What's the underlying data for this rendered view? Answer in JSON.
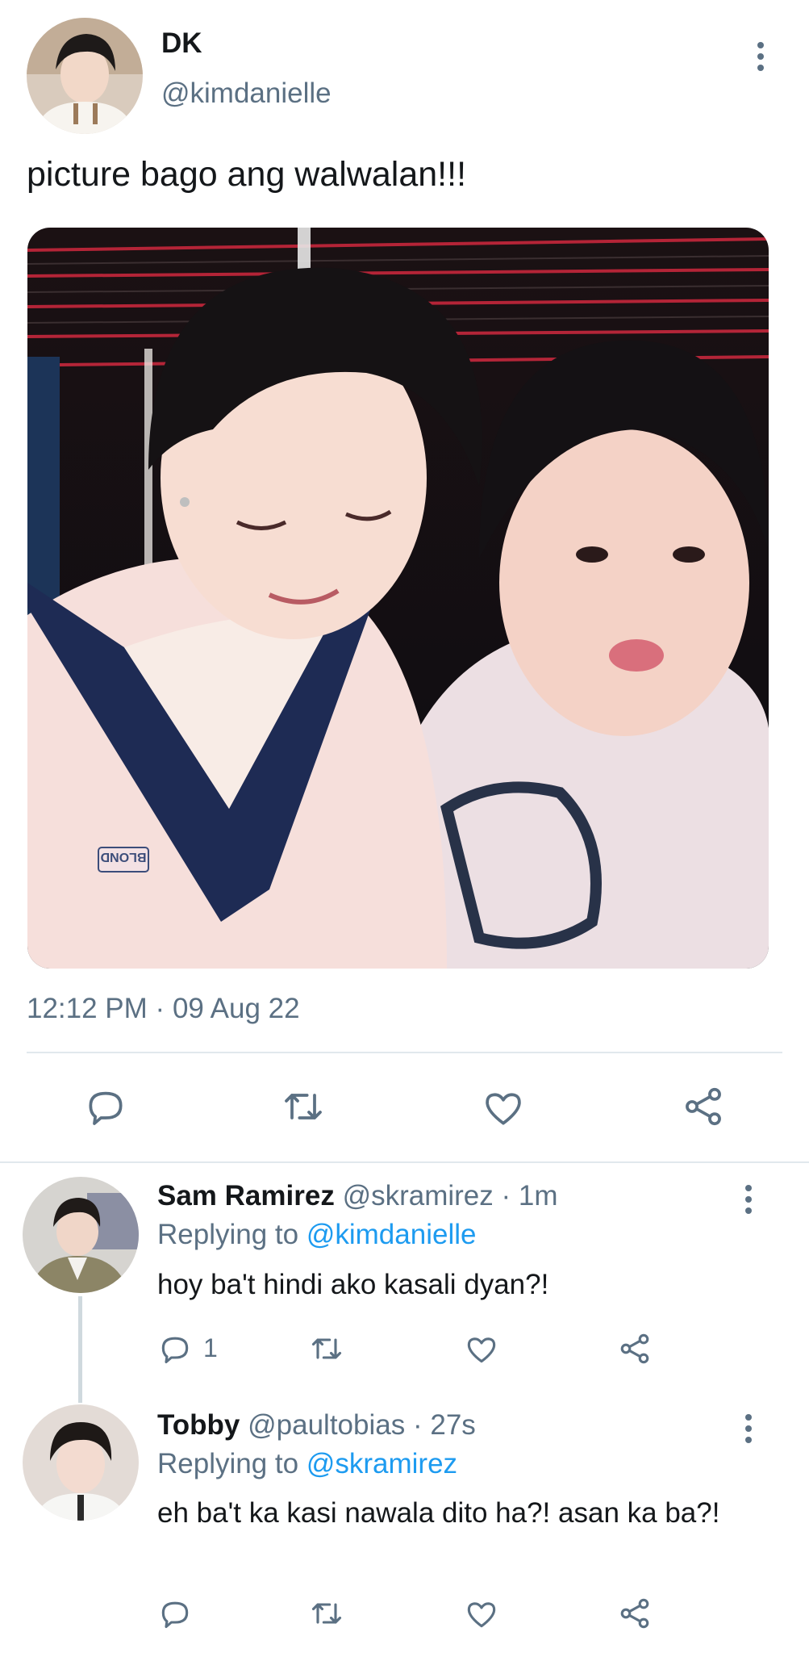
{
  "main_tweet": {
    "display_name": "DK",
    "handle": "@kimdanielle",
    "text": "picture bago ang walwalan!!!",
    "photo_text": "BLOND",
    "timestamp": "12:12 PM",
    "date": "09 Aug 22",
    "separator": "·"
  },
  "replies": [
    {
      "display_name": "Sam Ramirez",
      "handle": "@skramirez",
      "time": "1m",
      "separator": "·",
      "replying_label": "Replying to",
      "replying_to": "@kimdanielle",
      "text": "hoy ba't hindi ako kasali dyan?!",
      "reply_count": "1"
    },
    {
      "display_name": "Tobby",
      "handle": "@paultobias",
      "time": "27s",
      "separator": "·",
      "replying_label": "Replying to",
      "replying_to": "@skramirez",
      "text": "eh ba't ka kasi nawala dito ha?! asan ka ba?!",
      "reply_count": ""
    }
  ],
  "icons": [
    "more-icon",
    "reply-icon",
    "retweet-icon",
    "like-icon",
    "share-icon"
  ],
  "colors": {
    "link": "#1d9bf0",
    "muted": "#5b7083",
    "text": "#14171a",
    "divider": "#e1e8ed"
  }
}
